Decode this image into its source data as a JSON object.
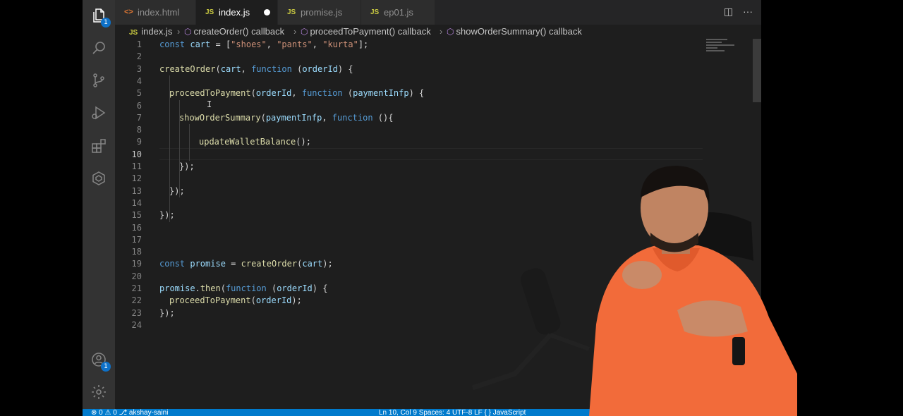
{
  "activity_bar": {
    "explorer_badge": "1",
    "accounts_badge": "1"
  },
  "tabs": [
    {
      "label": "index.html",
      "icon": "html-file-icon"
    },
    {
      "label": "index.js",
      "icon": "js-file-icon",
      "modified": true
    },
    {
      "label": "promise.js",
      "icon": "js-file-icon"
    },
    {
      "label": "ep01.js",
      "icon": "js-file-icon"
    }
  ],
  "file_icon_text": {
    "js": "JS",
    "html": "<>"
  },
  "breadcrumb": {
    "file": "index.js",
    "sym1": "createOrder() callback",
    "sym2": "proceedToPayment() callback",
    "sym3": "showOrderSummary() callback"
  },
  "line_numbers": [
    "1",
    "2",
    "3",
    "4",
    "5",
    "6",
    "7",
    "8",
    "9",
    "10",
    "11",
    "12",
    "13",
    "14",
    "15",
    "16",
    "17",
    "18",
    "19",
    "20",
    "21",
    "22",
    "23",
    "24"
  ],
  "current_line": 10,
  "code": {
    "l1": {
      "kw": "const",
      "var": "cart",
      "eq": " = [",
      "s1": "\"shoes\"",
      "c1": ", ",
      "s2": "\"pants\"",
      "c2": ", ",
      "s3": "\"kurta\"",
      "end": "];"
    },
    "l3": {
      "fn": "createOrder",
      "p1": "(",
      "var": "cart",
      "c": ", ",
      "kw": "function",
      "p2": " (",
      "arg": "orderId",
      "end": ") {"
    },
    "l5": {
      "fn": "proceedToPayment",
      "p1": "(",
      "var": "orderId",
      "c": ", ",
      "kw": "function",
      "p2": " (",
      "arg": "paymentInfp",
      "end": ") {"
    },
    "l7": {
      "fn": "showOrderSummary",
      "p1": "(",
      "var": "paymentInfp",
      "c": ", ",
      "kw": "function",
      "end": " (){"
    },
    "l9": {
      "fn": "updateWalletBalance",
      "end": "();"
    },
    "l11": "});",
    "l13": "});",
    "l15": "});",
    "l19": {
      "kw": "const",
      "var": "promise",
      "eq": " = ",
      "fn": "createOrder",
      "p1": "(",
      "arg": "cart",
      "end": ");"
    },
    "l21": {
      "var": "promise",
      "dot": ".",
      "fn": "then",
      "p1": "(",
      "kw": "function",
      "p2": " (",
      "arg": "orderId",
      "end": ") {"
    },
    "l22": {
      "fn": "proceedToPayment",
      "p1": "(",
      "arg": "orderId",
      "end": ");"
    },
    "l23": "});"
  },
  "status_bar": {
    "left": "⊗ 0  ⚠ 0    ⎇ akshay-saini",
    "right": "Ln 10, Col 9   Spaces: 4   UTF-8   LF   { } JavaScript"
  },
  "colors": {
    "keyword": "#569cd6",
    "variable": "#9cdcfe",
    "string": "#ce9178",
    "function": "#dcdcaa",
    "accent": "#007acc",
    "shirt": "#f26b3a"
  }
}
